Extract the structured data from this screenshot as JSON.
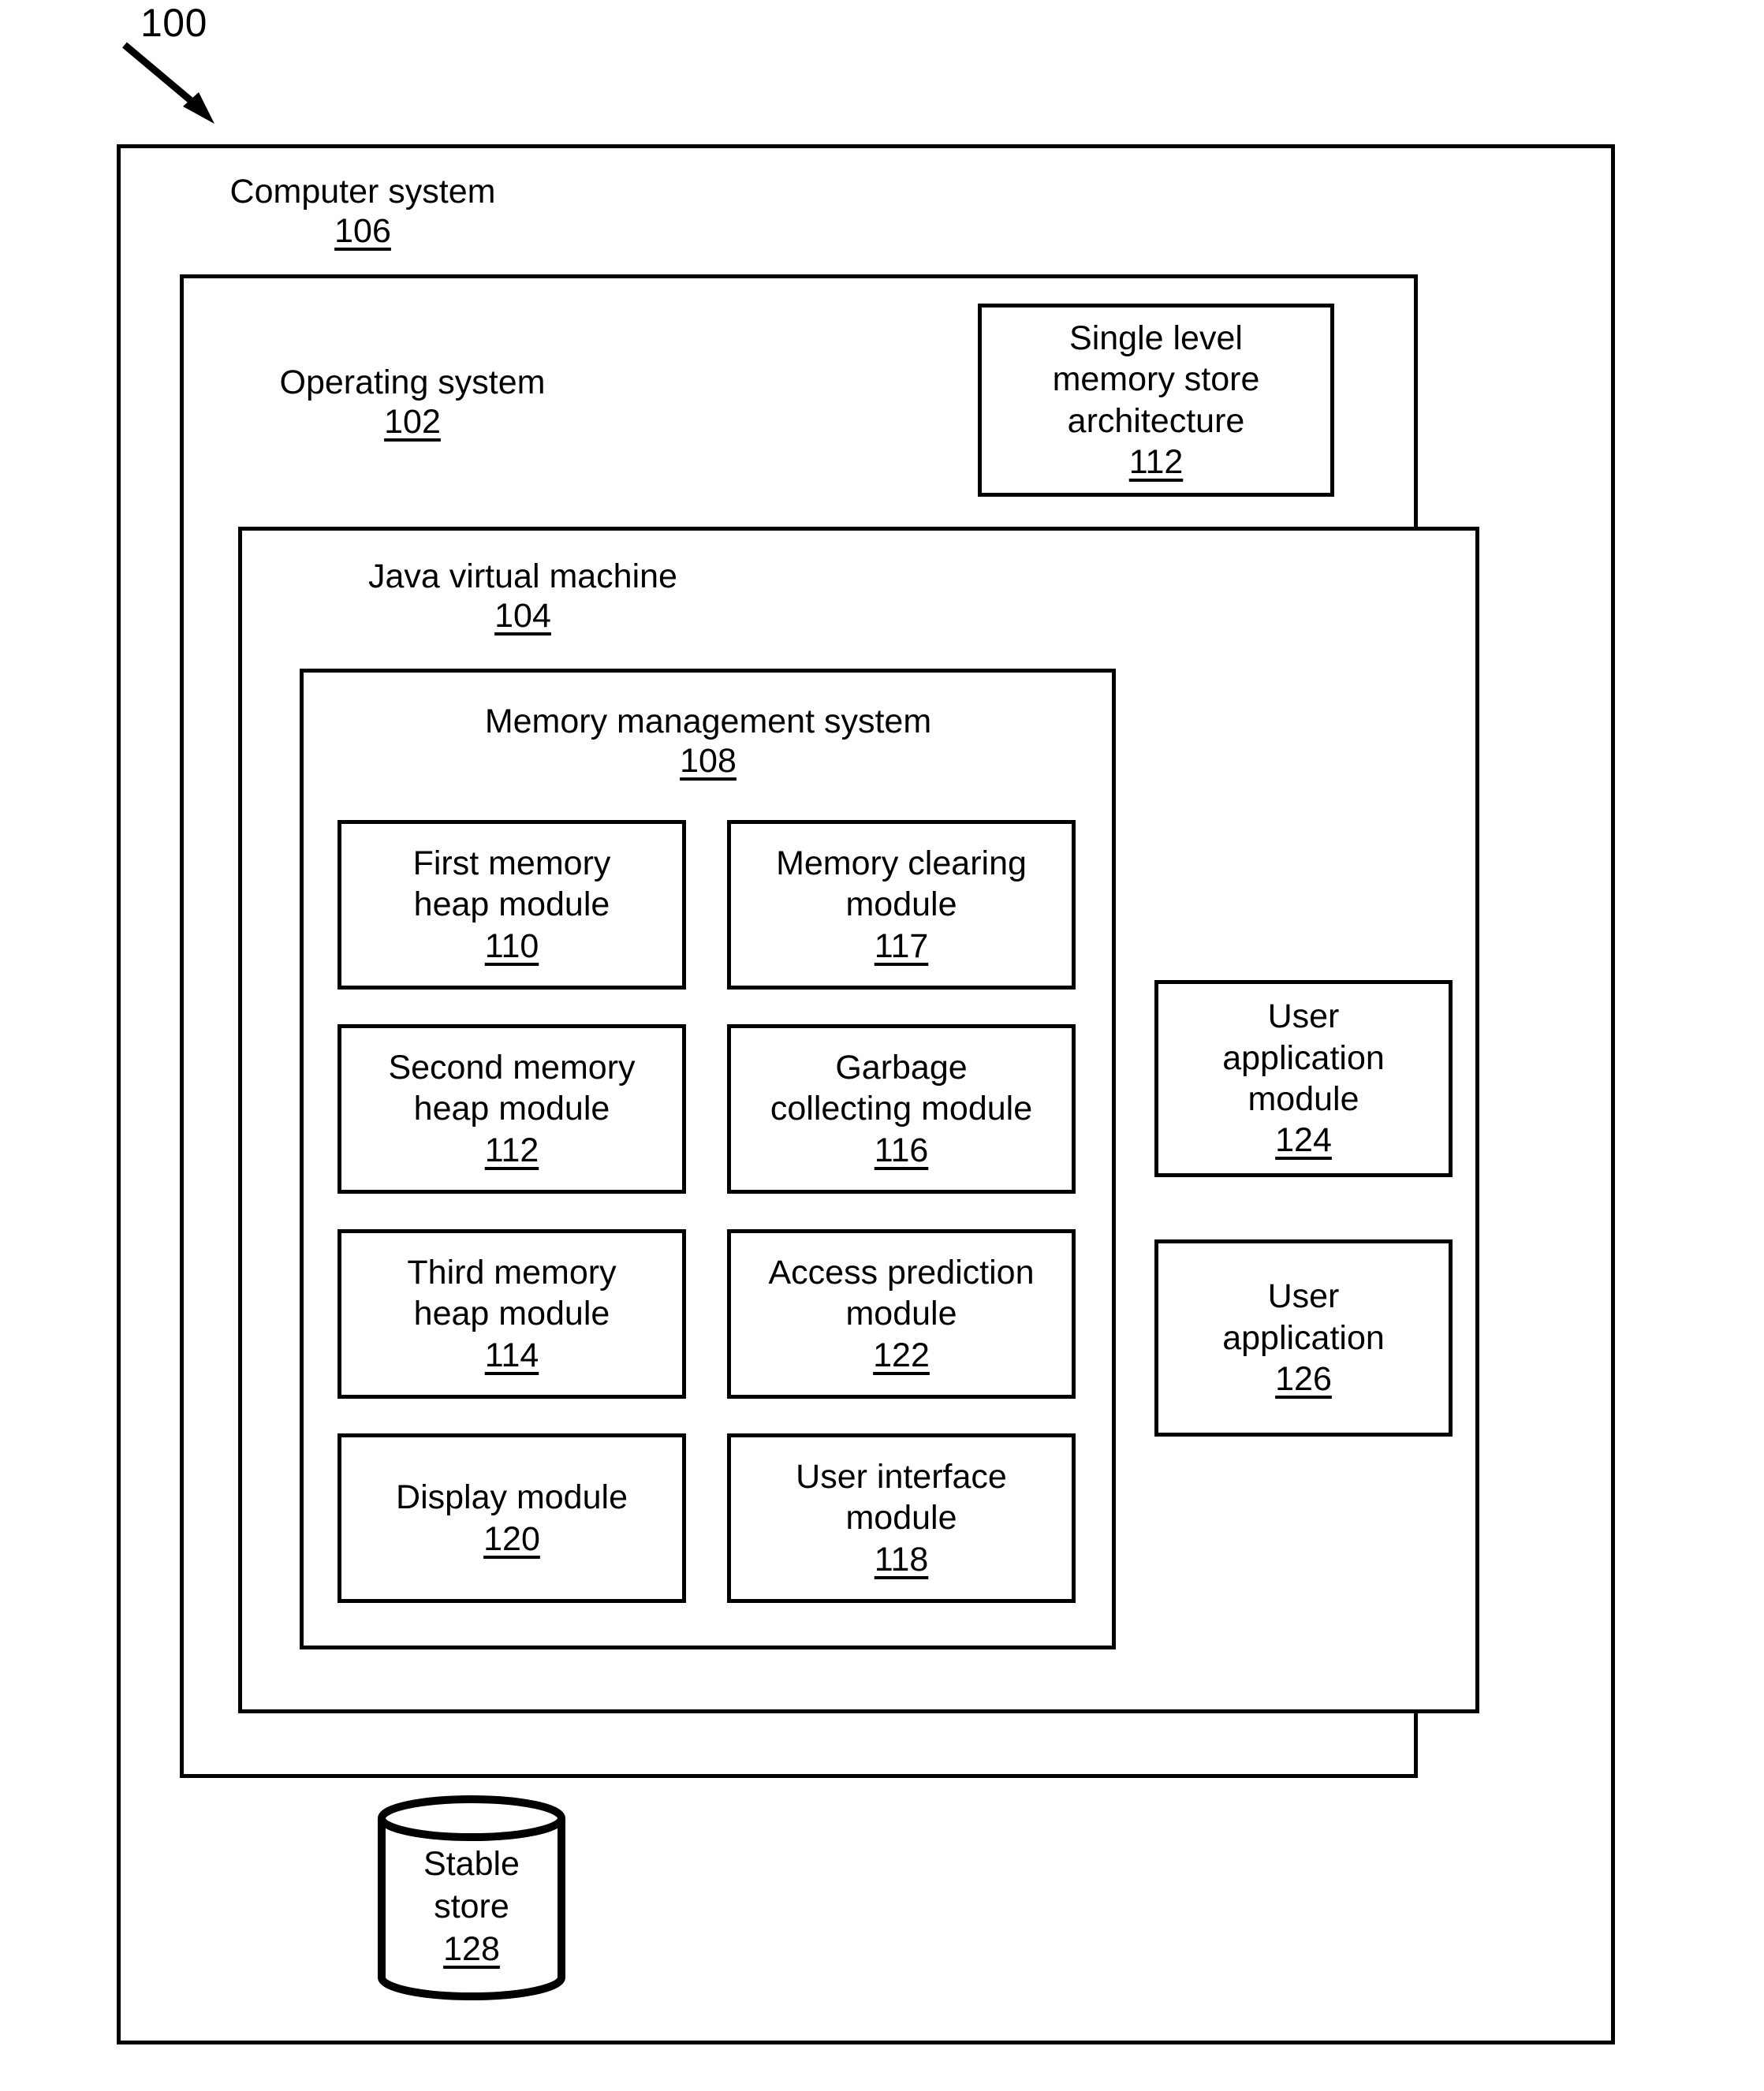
{
  "figure": {
    "reference_number": "100",
    "arrow_icon": "diagonal-arrow-icon"
  },
  "computer_system": {
    "title": "Computer system",
    "ref": "106"
  },
  "operating_system": {
    "title": "Operating system",
    "ref": "102"
  },
  "single_level_memory_store": {
    "line1": "Single level",
    "line2": "memory store",
    "line3": "architecture",
    "ref": "112"
  },
  "java_virtual_machine": {
    "title": "Java virtual machine",
    "ref": "104"
  },
  "memory_management_system": {
    "title": "Memory management system",
    "ref": "108"
  },
  "modules": [
    {
      "line1": "First memory",
      "line2": "heap module",
      "ref": "110"
    },
    {
      "line1": "Memory clearing",
      "line2": "module",
      "ref": "117"
    },
    {
      "line1": "Second memory",
      "line2": "heap module",
      "ref": "112"
    },
    {
      "line1": "Garbage",
      "line2": "collecting module",
      "ref": "116"
    },
    {
      "line1": "Third memory",
      "line2": "heap module",
      "ref": "114"
    },
    {
      "line1": "Access prediction",
      "line2": "module",
      "ref": "122"
    },
    {
      "line1": "Display module",
      "line2": "",
      "ref": "120"
    },
    {
      "line1": "User interface",
      "line2": "module",
      "ref": "118"
    }
  ],
  "user_applications": [
    {
      "line1": "User",
      "line2": "application",
      "line3": "module",
      "ref": "124"
    },
    {
      "line1": "User",
      "line2": "application",
      "line3": "",
      "ref": "126"
    }
  ],
  "stable_store": {
    "line1": "Stable",
    "line2": "store",
    "ref": "128"
  }
}
